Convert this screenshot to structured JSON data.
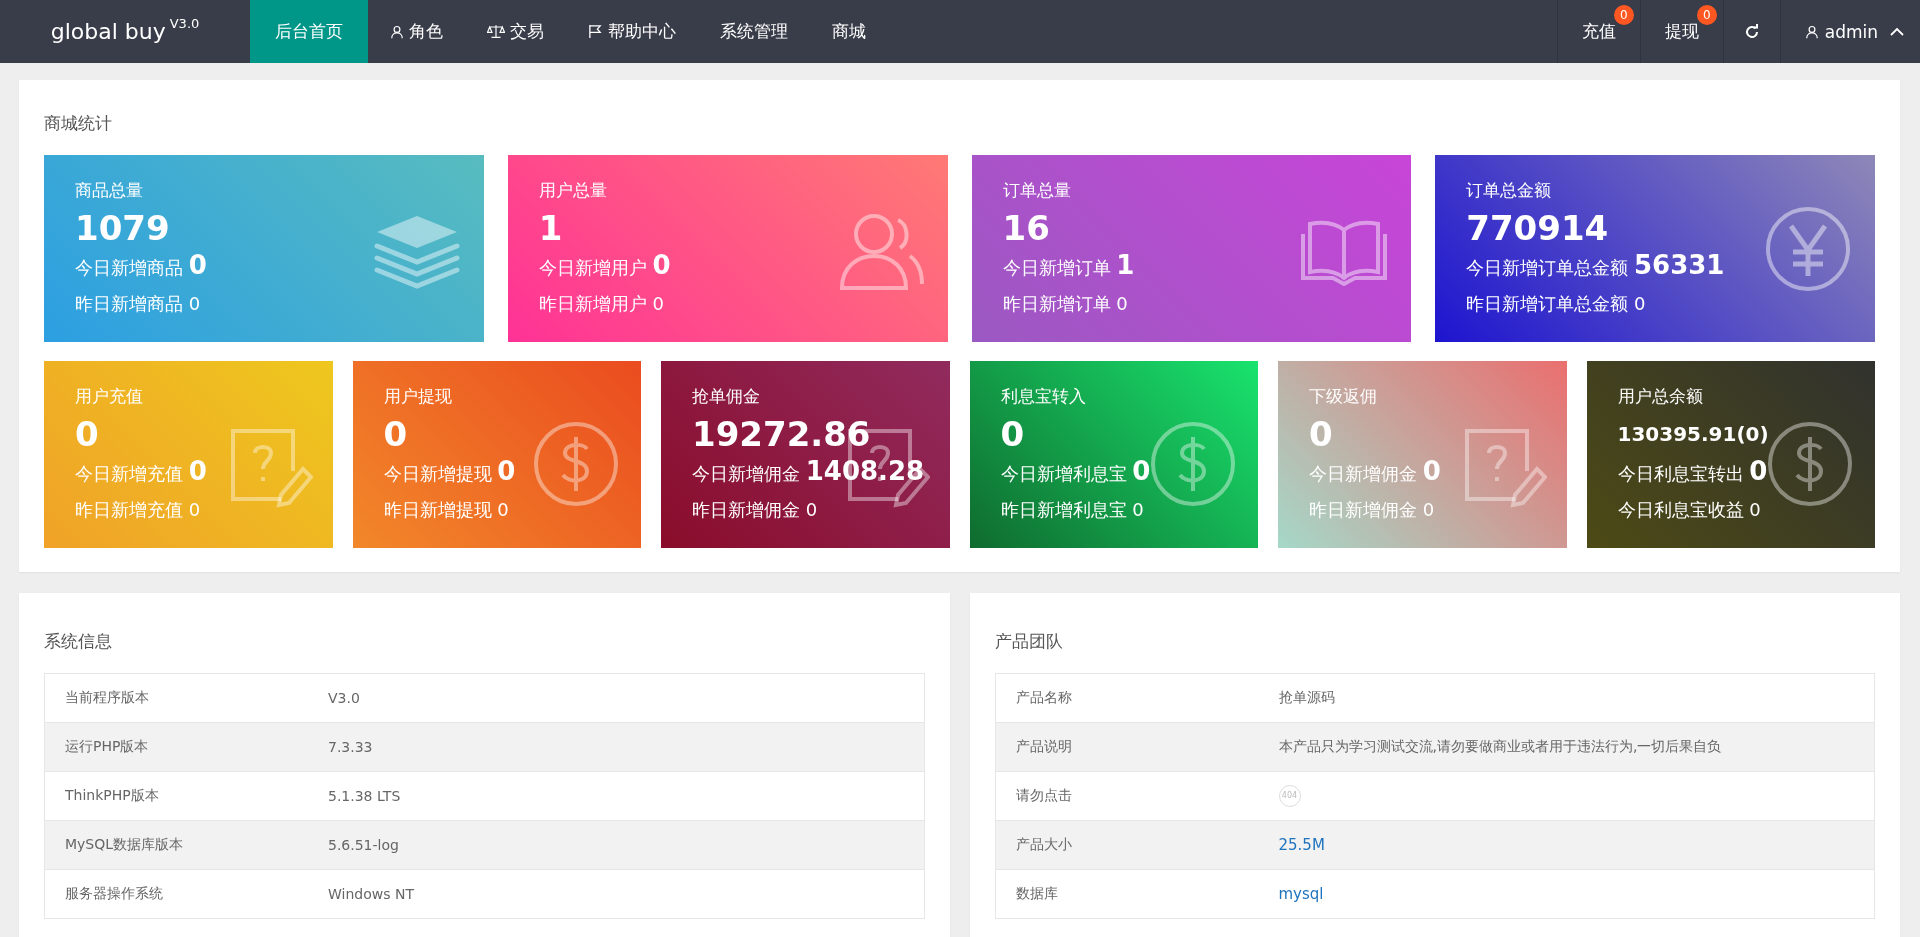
{
  "header": {
    "logo": "global buy",
    "version": "V3.0",
    "nav": [
      {
        "label": "后台首页",
        "selected": true
      },
      {
        "label": "角色",
        "selected": false
      },
      {
        "label": "交易",
        "selected": false
      },
      {
        "label": "帮助中心",
        "selected": false
      },
      {
        "label": "系统管理",
        "selected": false
      },
      {
        "label": "商城",
        "selected": false
      }
    ],
    "actions": [
      {
        "label": "充值",
        "badge": "0"
      },
      {
        "label": "提现",
        "badge": "0"
      }
    ],
    "user": "admin"
  },
  "stats": {
    "title": "商城统计",
    "cards": [
      {
        "title": "商品总量",
        "value": "1079",
        "today_label": "今日新增商品",
        "today_value": "0",
        "yesterday": "昨日新增商品 0"
      },
      {
        "title": "用户总量",
        "value": "1",
        "today_label": "今日新增用户",
        "today_value": "0",
        "yesterday": "昨日新增用户 0"
      },
      {
        "title": "订单总量",
        "value": "16",
        "today_label": "今日新增订单",
        "today_value": "1",
        "yesterday": "昨日新增订单 0"
      },
      {
        "title": "订单总金额",
        "value": "770914",
        "today_label": "今日新增订单总金额",
        "today_value": "56331",
        "yesterday": "昨日新增订单总金额 0"
      },
      {
        "title": "用户充值",
        "value": "0",
        "today_label": "今日新增充值",
        "today_value": "0",
        "yesterday": "昨日新增充值 0"
      },
      {
        "title": "用户提现",
        "value": "0",
        "today_label": "今日新增提现",
        "today_value": "0",
        "yesterday": "昨日新增提现 0"
      },
      {
        "title": "抢单佣金",
        "value": "19272.86",
        "today_label": "今日新增佣金",
        "today_value": "1408.28",
        "yesterday": "昨日新增佣金 0"
      },
      {
        "title": "利息宝转入",
        "value": "0",
        "today_label": "今日新增利息宝",
        "today_value": "0",
        "yesterday": "昨日新增利息宝 0"
      },
      {
        "title": "下级返佣",
        "value": "0",
        "today_label": "今日新增佣金",
        "today_value": "0",
        "yesterday": "昨日新增佣金 0"
      },
      {
        "title": "用户总余额",
        "value": "130395.91(0)",
        "today_label": "今日利息宝转出",
        "today_value": "0",
        "yesterday": "今日利息宝收益 0"
      }
    ]
  },
  "panels": [
    {
      "title": "系统信息",
      "rows": [
        {
          "label": "当前程序版本",
          "value": "V3.0",
          "kind": "text"
        },
        {
          "label": "运行PHP版本",
          "value": "7.3.33",
          "kind": "text"
        },
        {
          "label": "ThinkPHP版本",
          "value": "5.1.38 LTS",
          "kind": "text"
        },
        {
          "label": "MySQL数据库版本",
          "value": "5.6.51-log",
          "kind": "text"
        },
        {
          "label": "服务器操作系统",
          "value": "Windows NT",
          "kind": "text"
        }
      ]
    },
    {
      "title": "产品团队",
      "rows": [
        {
          "label": "产品名称",
          "value": "抢单源码",
          "kind": "text"
        },
        {
          "label": "产品说明",
          "value": "本产品只为学习测试交流,请勿要做商业或者用于违法行为,一切后果自负",
          "kind": "text"
        },
        {
          "label": "请勿点击",
          "value": "404",
          "kind": "badge"
        },
        {
          "label": "产品大小",
          "value": "25.5M",
          "kind": "link"
        },
        {
          "label": "数据库",
          "value": "mysql",
          "kind": "link"
        }
      ]
    }
  ]
}
